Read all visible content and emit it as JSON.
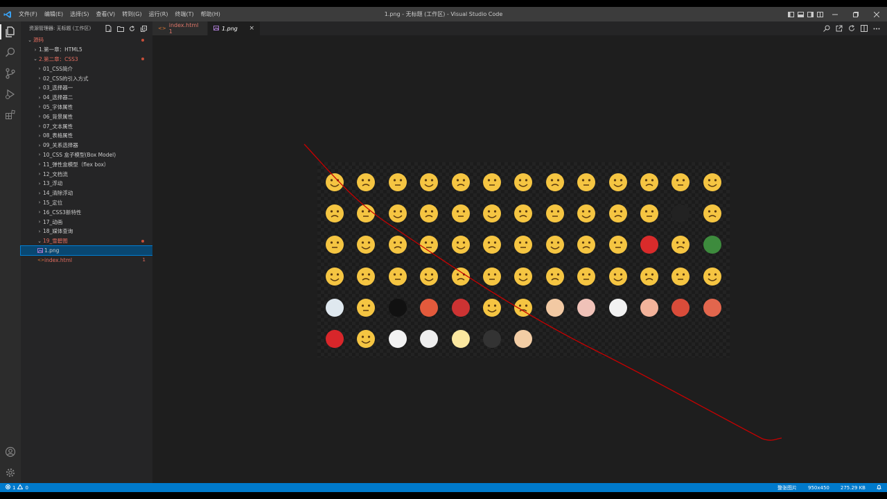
{
  "window": {
    "title": "1.png - 无标题 (工作区) - Visual Studio Code",
    "menu": [
      "文件(F)",
      "编辑(E)",
      "选择(S)",
      "查看(V)",
      "转到(G)",
      "运行(R)",
      "终端(T)",
      "帮助(H)"
    ]
  },
  "sidebar": {
    "header": "资源管理器: 无标题 (工作区)",
    "root": "源码",
    "chapter1": "1.第一章：HTML5",
    "chapter2": "2.第二章：CSS3",
    "items": [
      "01_CSS简介",
      "02_CSS的引入方式",
      "03_选择器一",
      "04_选择器二",
      "05_字体属性",
      "06_背景属性",
      "07_文本属性",
      "08_表格属性",
      "09_关系选择器",
      "10_CSS 盒子模型(Box Model)",
      "11_弹性盒模型（flex box）",
      "12_文档流",
      "13_浮动",
      "14_清除浮动",
      "15_定位",
      "16_CSS3新特性",
      "17_动画",
      "18_媒体查询"
    ],
    "folder19": "19_雪碧图",
    "file_png": "1.png",
    "file_html": "index.html",
    "file_html_badge": "1"
  },
  "tabs": [
    {
      "label": "index.html 1",
      "active": false
    },
    {
      "label": "1.png",
      "active": true
    }
  ],
  "status": {
    "errors": "1",
    "warnings": "0",
    "image_label": "整张图片",
    "dimensions": "950x450",
    "filesize": "275.29 KB"
  },
  "colors": {
    "accent": "#007acc",
    "git_modified": "#e06c5f",
    "emoji_yellow": "#f5c542",
    "annotation_red": "#c80000"
  },
  "emoji_rows": [
    13,
    13,
    13,
    13,
    13,
    7
  ]
}
